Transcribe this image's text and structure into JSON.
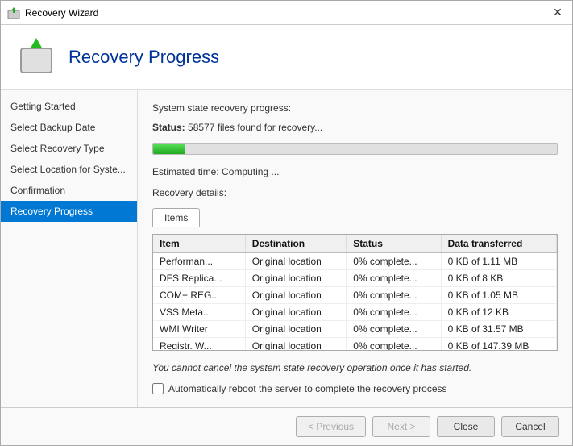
{
  "window": {
    "title": "Recovery Wizard",
    "close_icon": "✕"
  },
  "header": {
    "title": "Recovery Progress"
  },
  "sidebar": {
    "items": [
      {
        "id": "getting-started",
        "label": "Getting Started",
        "active": false
      },
      {
        "id": "select-backup-date",
        "label": "Select Backup Date",
        "active": false
      },
      {
        "id": "select-recovery-type",
        "label": "Select Recovery Type",
        "active": false
      },
      {
        "id": "select-location",
        "label": "Select Location for Syste...",
        "active": false
      },
      {
        "id": "confirmation",
        "label": "Confirmation",
        "active": false
      },
      {
        "id": "recovery-progress",
        "label": "Recovery Progress",
        "active": true
      }
    ]
  },
  "main": {
    "section_label": "System state recovery progress:",
    "status_label": "Status:",
    "status_value": "58577 files found for recovery...",
    "progress_percent": 8,
    "estimated_time_label": "Estimated time:",
    "estimated_time_value": "Computing ...",
    "recovery_details_label": "Recovery details:",
    "tab_label": "Items",
    "table": {
      "columns": [
        "Item",
        "Destination",
        "Status",
        "Data transferred"
      ],
      "rows": [
        {
          "item": "Performan...",
          "destination": "Original location",
          "status": "0% complete...",
          "data": "0 KB of 1.11 MB"
        },
        {
          "item": "DFS Replica...",
          "destination": "Original location",
          "status": "0% complete...",
          "data": "0 KB of 8 KB"
        },
        {
          "item": "COM+ REG...",
          "destination": "Original location",
          "status": "0% complete...",
          "data": "0 KB of 1.05 MB"
        },
        {
          "item": "VSS Meta...",
          "destination": "Original location",
          "status": "0% complete...",
          "data": "0 KB of 12 KB"
        },
        {
          "item": "WMI Writer",
          "destination": "Original location",
          "status": "0% complete...",
          "data": "0 KB of 31.57 MB"
        },
        {
          "item": "Registr. W...",
          "destination": "Original location",
          "status": "0% complete...",
          "data": "0 KB of 147.39 MB"
        }
      ]
    },
    "warning_text": "You cannot cancel the system state recovery operation once it has started.",
    "checkbox_label": "Automatically reboot the server to complete the recovery process"
  },
  "footer": {
    "previous_label": "< Previous",
    "next_label": "Next >",
    "close_label": "Close",
    "cancel_label": "Cancel"
  }
}
